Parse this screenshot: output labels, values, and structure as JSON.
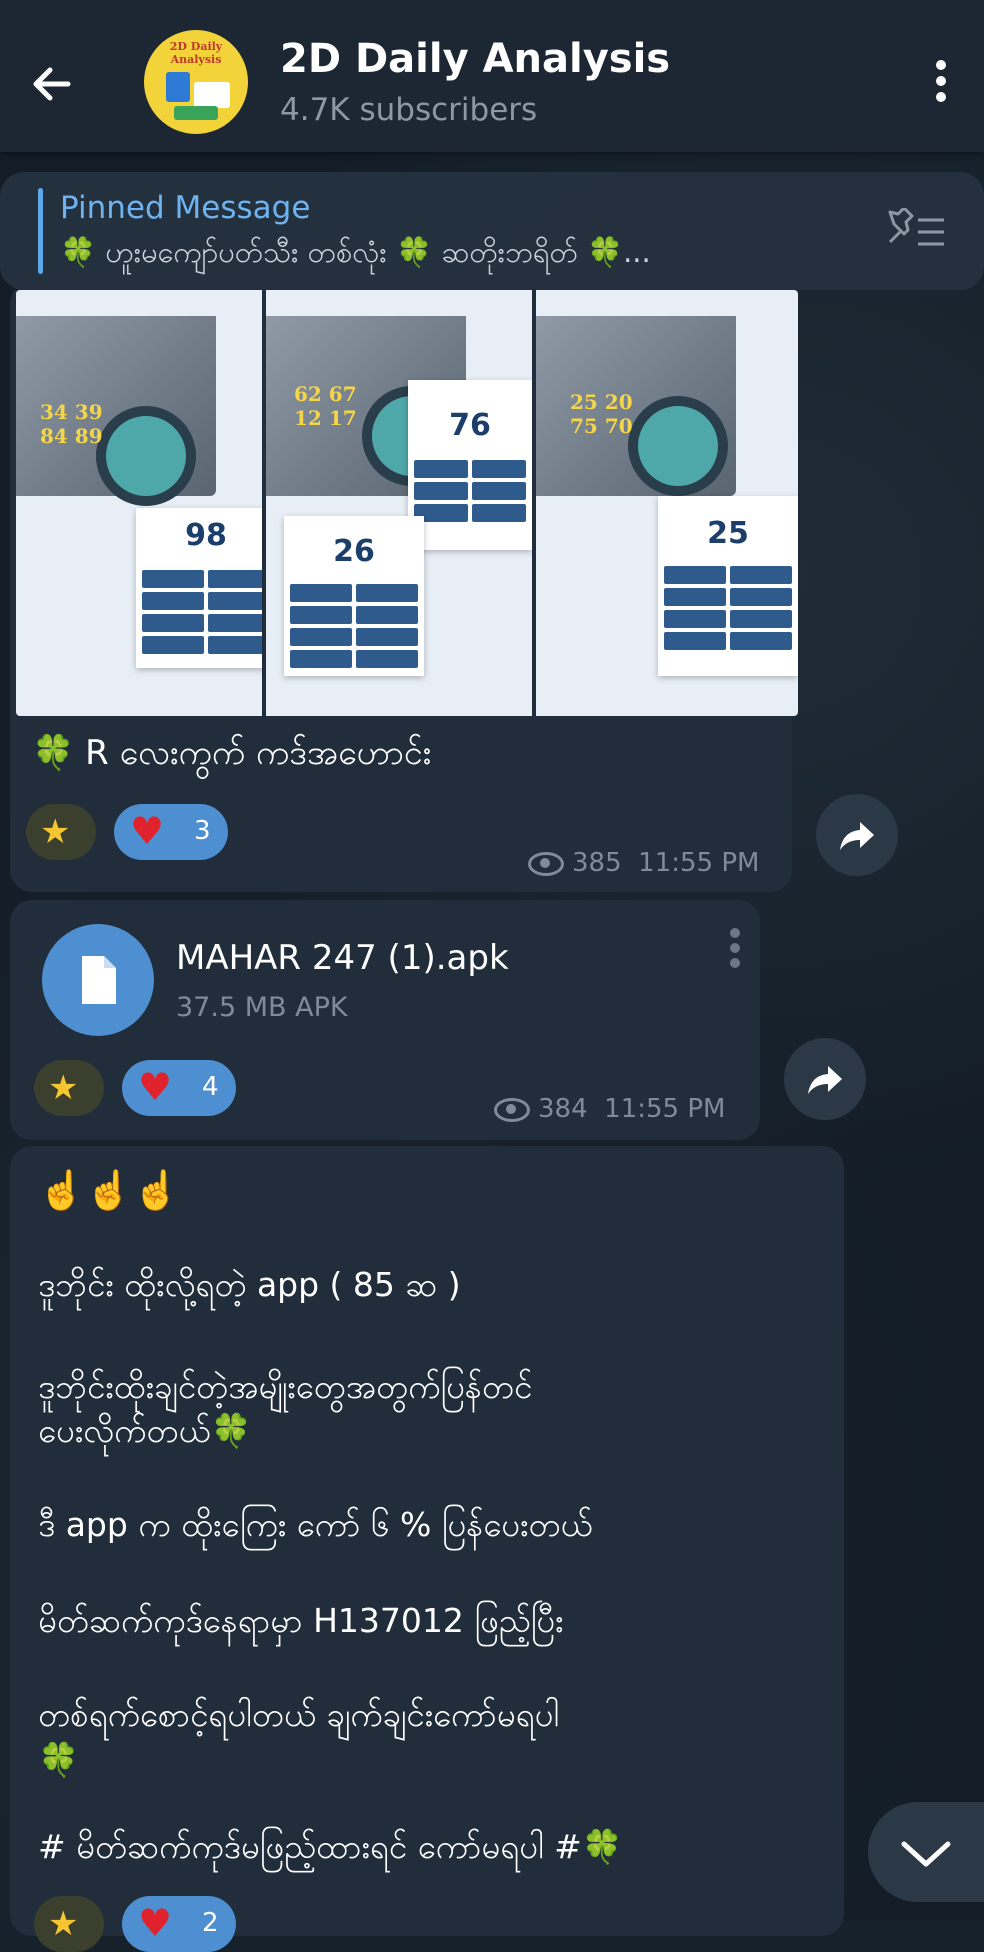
{
  "header": {
    "title": "2D Daily Analysis",
    "subscribers": "4.7K subscribers",
    "avatar_text": "2D Daily Analysis"
  },
  "pinned": {
    "title": "Pinned Message",
    "text": "🍀 ဟူးမကျော်ပတ်သီး တစ်လုံး 🍀 ဆတိုးဘရိတ် 🍀..."
  },
  "messages": [
    {
      "photos": [
        {
          "pair_top": "34 39",
          "pair_bottom": "84 89",
          "result": "98"
        },
        {
          "pair_top": "62 67",
          "pair_bottom": "12 17",
          "result_top": "76",
          "result": "26"
        },
        {
          "pair_top": "25 20",
          "pair_bottom": "75 70",
          "result": "25"
        }
      ],
      "caption": "🍀 R လေးကွက် ကဒ်အဟောင်း",
      "reactions": {
        "heart_count": "3"
      },
      "views": "385",
      "time": "11:55 PM"
    },
    {
      "file_name": "MAHAR 247 (1).apk",
      "file_size": "37.5 MB APK",
      "reactions": {
        "heart_count": "4"
      },
      "views": "384",
      "time": "11:55 PM"
    },
    {
      "lines": [
        "☝️☝️☝️",
        "ဒူဘိုင်း ထိုးလို့ရတဲ့ app ( 85 ဆ )",
        "ဒူဘိုင်းထိုးချင်တဲ့အမျိုးတွေအတွက်ပြန်တင်",
        "ပေးလိုက်တယ်🍀",
        "ဒီ app က ထိုးကြေး ကော် ၆ % ပြန်ပေးတယ်",
        "မိတ်ဆက်ကုဒ်နေရာမှာ H137012 ဖြည့်ပြီး",
        "တစ်ရက်စောင့်ရပါတယ် ချက်ချင်းကော်မရပါ",
        "🍀",
        "# မိတ်ဆက်ကုဒ်မဖြည့်ထားရင် ကော်မရပါ #🍀"
      ],
      "reactions": {
        "heart_count": "2"
      }
    }
  ]
}
